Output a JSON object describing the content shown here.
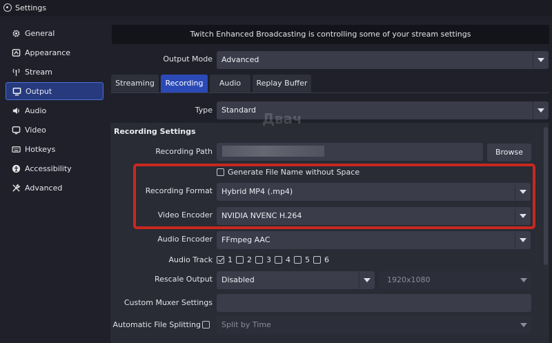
{
  "window": {
    "title": "Settings"
  },
  "sidebar": {
    "items": [
      {
        "label": "General",
        "icon": "gear-icon",
        "active": false
      },
      {
        "label": "Appearance",
        "icon": "appearance-icon",
        "active": false
      },
      {
        "label": "Stream",
        "icon": "antenna-icon",
        "active": false
      },
      {
        "label": "Output",
        "icon": "monitor-icon",
        "active": true
      },
      {
        "label": "Audio",
        "icon": "speaker-icon",
        "active": false
      },
      {
        "label": "Video",
        "icon": "video-monitor-icon",
        "active": false
      },
      {
        "label": "Hotkeys",
        "icon": "keyboard-icon",
        "active": false
      },
      {
        "label": "Accessibility",
        "icon": "accessibility-icon",
        "active": false
      },
      {
        "label": "Advanced",
        "icon": "wrench-icon",
        "active": false
      }
    ]
  },
  "banner": {
    "text": "Twitch Enhanced Broadcasting is controlling some of your stream settings"
  },
  "output_mode": {
    "label": "Output Mode",
    "value": "Advanced"
  },
  "tabs": [
    {
      "label": "Streaming",
      "active": false
    },
    {
      "label": "Recording",
      "active": true
    },
    {
      "label": "Audio",
      "active": false
    },
    {
      "label": "Replay Buffer",
      "active": false
    }
  ],
  "type": {
    "label": "Type",
    "value": "Standard"
  },
  "recording_settings": {
    "title": "Recording Settings",
    "path_label": "Recording Path",
    "browse_label": "Browse",
    "generate_filename_label": "Generate File Name without Space",
    "generate_filename_checked": false,
    "format_label": "Recording Format",
    "format_value": "Hybrid MP4 (.mp4)",
    "video_encoder_label": "Video Encoder",
    "video_encoder_value": "NVIDIA NVENC H.264",
    "audio_encoder_label": "Audio Encoder",
    "audio_encoder_value": "FFmpeg AAC",
    "audio_track_label": "Audio Track",
    "audio_tracks": [
      {
        "label": "1",
        "checked": true
      },
      {
        "label": "2",
        "checked": false
      },
      {
        "label": "3",
        "checked": false
      },
      {
        "label": "4",
        "checked": false
      },
      {
        "label": "5",
        "checked": false
      },
      {
        "label": "6",
        "checked": false
      }
    ],
    "rescale_label": "Rescale Output",
    "rescale_value": "Disabled",
    "rescale_resolution": "1920x1080",
    "muxer_label": "Custom Muxer Settings",
    "muxer_value": "",
    "splitting_label": "Automatic File Splitting",
    "splitting_checked": false,
    "splitting_value": "Split by Time"
  },
  "watermark": {
    "text": "Двач"
  },
  "colors": {
    "accent": "#2b4ab7",
    "highlight": "#c8281e",
    "background": "#1f2029"
  }
}
